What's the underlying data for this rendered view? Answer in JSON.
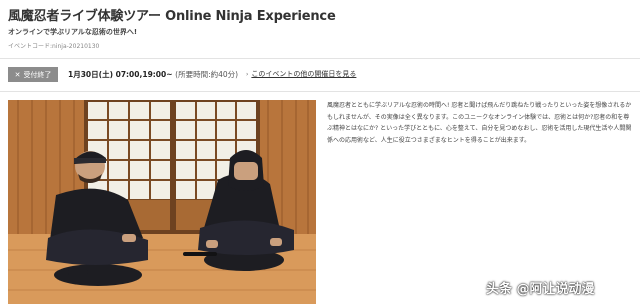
{
  "header": {
    "title": "風魔忍者ライブ体験ツアー Online Ninja Experience",
    "subtitle": "オンラインで学ぶリアルな忍術の世界へ!",
    "event_code": "イベントコード:ninja-20210130"
  },
  "info_bar": {
    "status_badge": "受付終了",
    "date_text": "1月30日(土) 07:00,19:00~",
    "duration_text": "(所要時間:約40分)",
    "other_dates_link": "このイベントの他の開催日を見る"
  },
  "description": "風魔忍者とともに学ぶリアルな忍術の時間へ! 忍者と聞けば飛んだり跳ねたり戦ったりといった姿を想像されるかもしれませんが、その実像は全く異なります。このユニークなオンライン体験では、忍術とは何か?忍者の和を尊ぶ精神とはなにか? といった学びとともに、心を整えて、自分を見つめなおし、忍術を活用した現代生活や人間関係への応用術など、人生に役立つさまざまなヒントを得ることが出来ます。",
  "watermark": "头条 @阿让说动漫",
  "colors": {
    "badge_bg": "#8c8c8c",
    "wood": "#b8753c",
    "floor": "#d99a5b",
    "costume": "#1d1d22"
  }
}
